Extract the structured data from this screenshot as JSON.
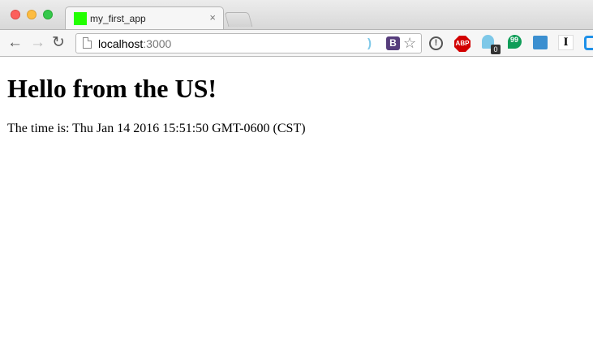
{
  "tab": {
    "title": "my_first_app",
    "close_glyph": "×",
    "favicon_color": "#22ff00"
  },
  "toolbar": {
    "back_glyph": "←",
    "forward_glyph": "→",
    "reload_glyph": "↻",
    "url_host": "localhost",
    "url_port": ":3000",
    "bootstrap_glyph": "B",
    "star_glyph": "☆"
  },
  "extensions": {
    "abp_label": "ABP",
    "ghost_badge": "0",
    "i_label": "I",
    "info_label": "!"
  },
  "page": {
    "heading": "Hello from the US!",
    "time_line": "The time is: Thu Jan 14 2016 15:51:50 GMT-0600 (CST)"
  }
}
